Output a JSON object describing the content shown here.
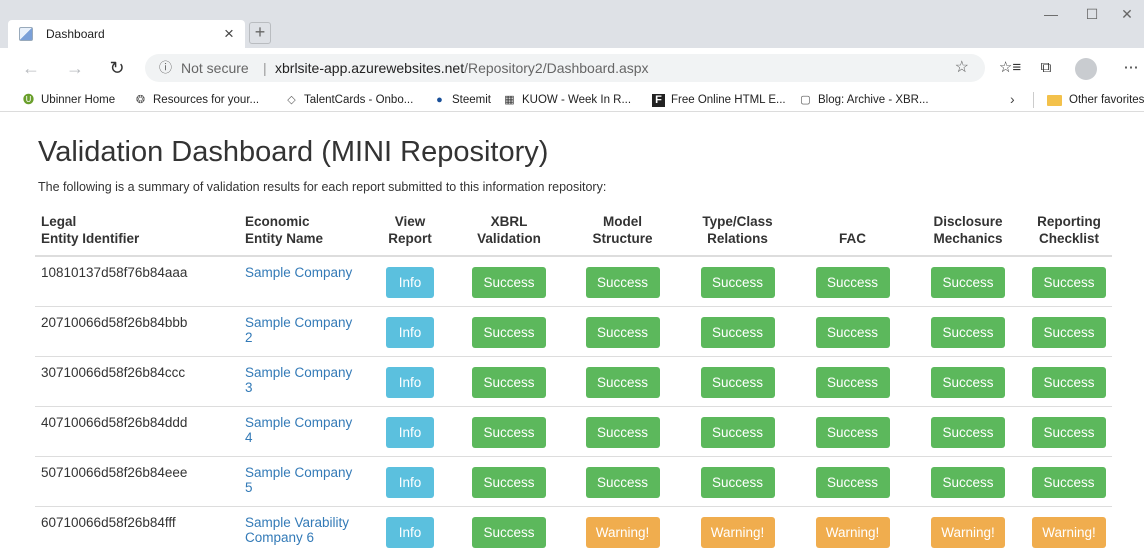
{
  "browser": {
    "tab_title": "Dashboard",
    "tab_close": "×",
    "new_tab": "+",
    "win_min": "—",
    "win_max": "☐",
    "win_close": "✕",
    "back": "←",
    "forward": "→",
    "refresh": "↻",
    "url_info": "ⓘ",
    "url_security": "Not secure",
    "url_separator": "|",
    "url_host": "xbrlsite-app.azurewebsites.net",
    "url_path": "/Repository2/Dashboard.aspx",
    "star": "☆",
    "favorites_icon": "☆≡",
    "collections_icon": "⧉",
    "more_icon": "⋯",
    "bookmarks": [
      {
        "label": "Ubinner Home",
        "icon": "🅤"
      },
      {
        "label": "Resources for your...",
        "icon": "❂"
      },
      {
        "label": "TalentCards - Onbo...",
        "icon": "◇"
      },
      {
        "label": "Steemit",
        "icon": "●"
      },
      {
        "label": "KUOW - Week In R...",
        "icon": "▦"
      },
      {
        "label": "Free Online HTML E...",
        "icon": "F"
      },
      {
        "label": "Blog: Archive - XBR...",
        "icon": "▢"
      }
    ],
    "bookmarks_more": "›",
    "other_favorites": "Other favorites"
  },
  "page": {
    "title": "Validation Dashboard (MINI Repository)",
    "description": "The following is a summary of validation results for each report submitted to this information repository:"
  },
  "table": {
    "headers": {
      "entity_id": [
        "Legal",
        "Entity Identifier"
      ],
      "entity_name": [
        "Economic",
        "Entity Name"
      ],
      "view": [
        "View",
        "Report"
      ],
      "xbrl": [
        "XBRL",
        "Validation"
      ],
      "model": [
        "Model",
        "Structure"
      ],
      "type": [
        "Type/Class",
        "Relations"
      ],
      "fac": [
        "",
        "FAC"
      ],
      "disclosure": [
        "Disclosure",
        "Mechanics"
      ],
      "checklist": [
        "Reporting",
        "Checklist"
      ]
    },
    "rows": [
      {
        "id": "10810137d58f76b84aaa",
        "name": "Sample Company",
        "view": "Info",
        "xbrl": "Success",
        "model": "Success",
        "type": "Success",
        "fac": "Success",
        "disclosure": "Success",
        "checklist": "Success"
      },
      {
        "id": "20710066d58f26b84bbb",
        "name": "Sample Company 2",
        "view": "Info",
        "xbrl": "Success",
        "model": "Success",
        "type": "Success",
        "fac": "Success",
        "disclosure": "Success",
        "checklist": "Success"
      },
      {
        "id": "30710066d58f26b84ccc",
        "name": "Sample Company 3",
        "view": "Info",
        "xbrl": "Success",
        "model": "Success",
        "type": "Success",
        "fac": "Success",
        "disclosure": "Success",
        "checklist": "Success"
      },
      {
        "id": "40710066d58f26b84ddd",
        "name": "Sample Company 4",
        "view": "Info",
        "xbrl": "Success",
        "model": "Success",
        "type": "Success",
        "fac": "Success",
        "disclosure": "Success",
        "checklist": "Success"
      },
      {
        "id": "50710066d58f26b84eee",
        "name": "Sample Company 5",
        "view": "Info",
        "xbrl": "Success",
        "model": "Success",
        "type": "Success",
        "fac": "Success",
        "disclosure": "Success",
        "checklist": "Success"
      },
      {
        "id": "60710066d58f26b84fff",
        "name": "Sample Varability Company 6",
        "view": "Info",
        "xbrl": "Success",
        "model": "Warning!",
        "type": "Warning!",
        "fac": "Warning!",
        "disclosure": "Warning!",
        "checklist": "Warning!"
      }
    ]
  },
  "colors": {
    "info": "#5bc0de",
    "success": "#5cb85c",
    "warning": "#f0ad4e",
    "link": "#337ab7"
  }
}
